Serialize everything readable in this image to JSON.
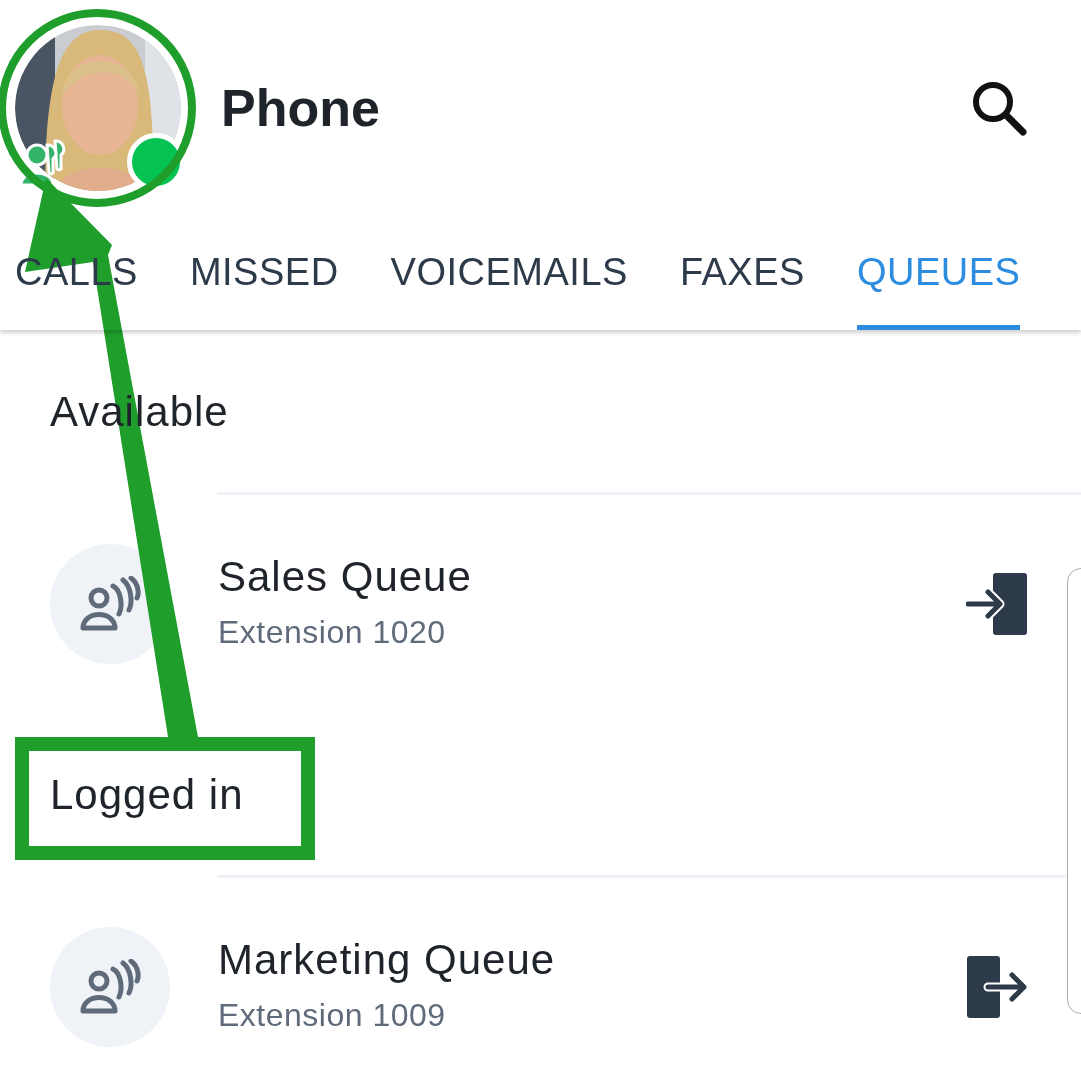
{
  "header": {
    "title": "Phone",
    "online": true
  },
  "tabs": [
    {
      "label": "CALLS",
      "selected": false
    },
    {
      "label": "MISSED",
      "selected": false
    },
    {
      "label": "VOICEMAILS",
      "selected": false
    },
    {
      "label": "FAXES",
      "selected": false
    },
    {
      "label": "QUEUES",
      "selected": true
    }
  ],
  "sections": [
    {
      "title": "Available",
      "queues": [
        {
          "name": "Sales Queue",
          "extension": "Extension 1020",
          "logged_in": false
        }
      ]
    },
    {
      "title": "Logged in",
      "queues": [
        {
          "name": "Marketing Queue",
          "extension": "Extension 1009",
          "logged_in": true
        }
      ]
    }
  ]
}
